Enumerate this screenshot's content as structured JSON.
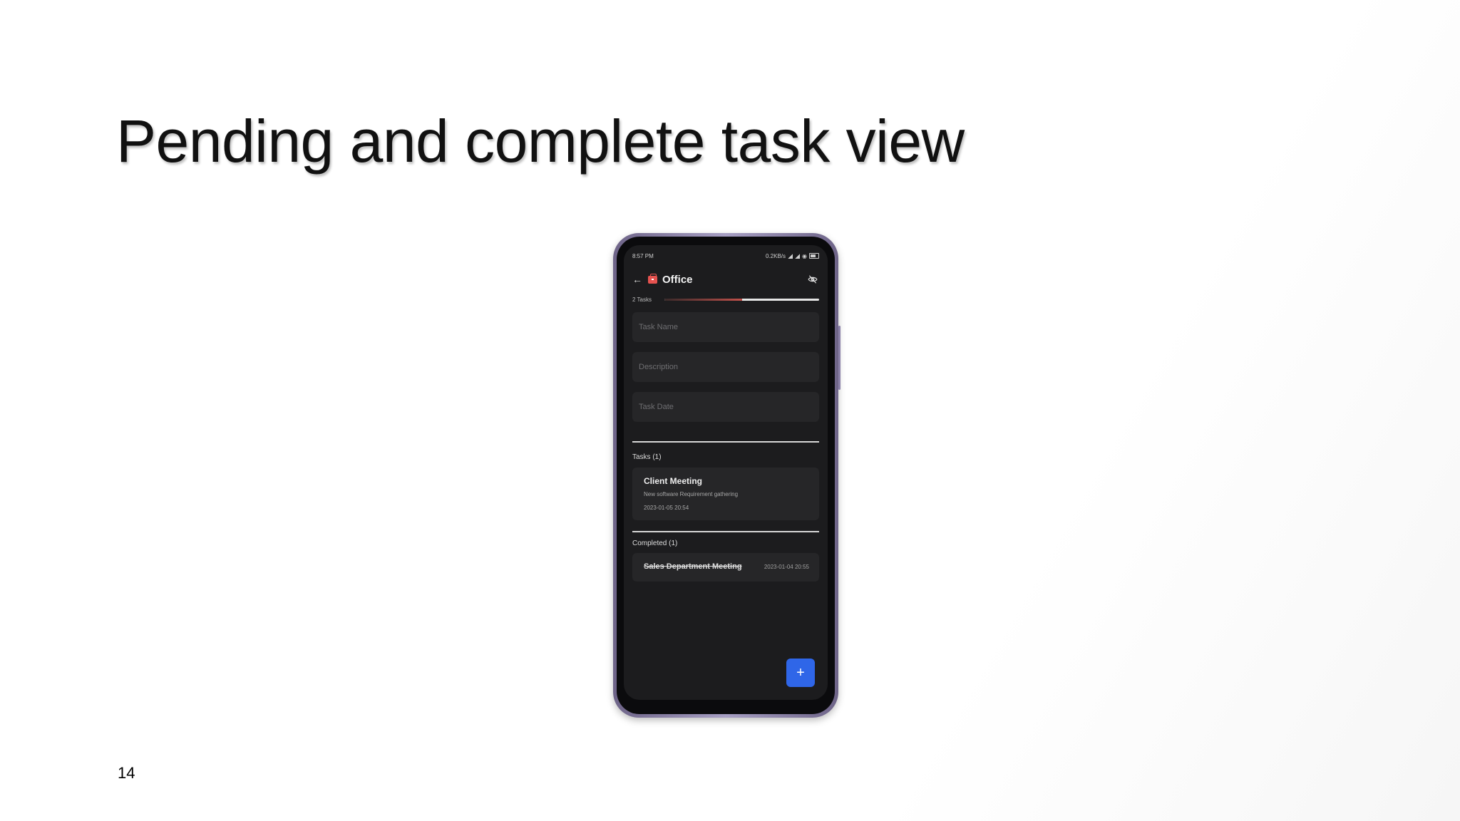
{
  "slide": {
    "title": "Pending and complete task view",
    "page_number": "14"
  },
  "status_bar": {
    "time": "8:57 PM",
    "network": "0.2KB/s"
  },
  "app_bar": {
    "title": "Office",
    "icons": {
      "back": "arrow-back-icon",
      "category": "folder-icon",
      "visibility": "eye-off-icon"
    },
    "accent_color": "#e5524f"
  },
  "progress": {
    "label": "2 Tasks",
    "completed_fraction": 0.5
  },
  "form": {
    "task_name_placeholder": "Task Name",
    "description_placeholder": "Description",
    "task_date_placeholder": "Task Date"
  },
  "pending": {
    "header": "Tasks (1)",
    "items": [
      {
        "title": "Client Meeting",
        "description": "New software Requirement gathering",
        "date": "2023-01-05 20:54"
      }
    ]
  },
  "completed": {
    "header": "Completed (1)",
    "items": [
      {
        "title": "Sales Department Meeting",
        "date": "2023-01-04 20:55"
      }
    ]
  },
  "fab": {
    "label": "+",
    "color": "#2f66e8"
  }
}
